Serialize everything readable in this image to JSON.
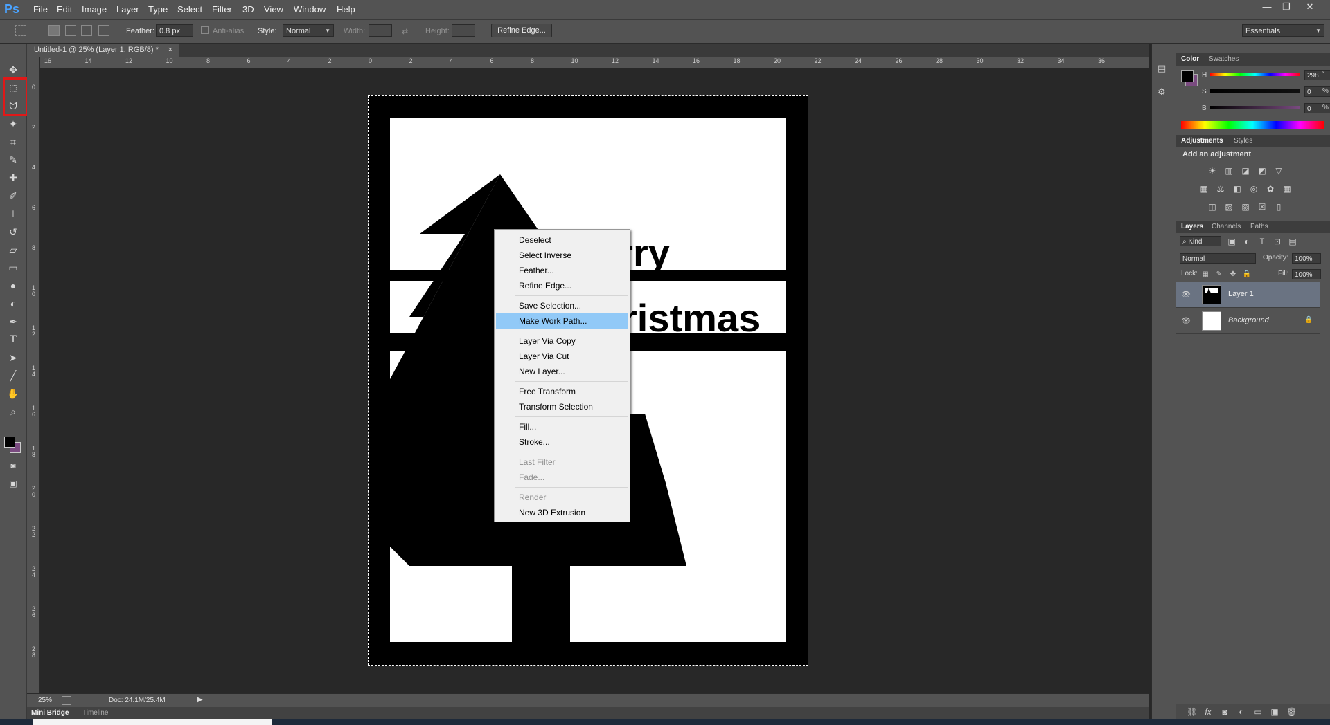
{
  "app": {
    "logo": "Ps",
    "menus": [
      "File",
      "Edit",
      "Image",
      "Layer",
      "Type",
      "Select",
      "Filter",
      "3D",
      "View",
      "Window",
      "Help"
    ],
    "window_controls": [
      "—",
      "❐",
      "✕"
    ]
  },
  "options_bar": {
    "feather_label": "Feather:",
    "feather_value": "0.8 px",
    "anti_alias_label": "Anti-alias",
    "style_label": "Style:",
    "style_value": "Normal",
    "width_label": "Width:",
    "height_label": "Height:",
    "refine_edge": "Refine Edge...",
    "workspace": "Essentials"
  },
  "document": {
    "tab_title": "Untitled-1 @ 25% (Layer 1, RGB/8) *",
    "close": "×",
    "canvas_text": {
      "word1": "erry",
      "word2": "ristmas"
    }
  },
  "ruler": {
    "h_ticks": [
      "16",
      "14",
      "12",
      "10",
      "8",
      "6",
      "4",
      "2",
      "0",
      "2",
      "4",
      "6",
      "8",
      "10",
      "12",
      "14",
      "16",
      "18",
      "20",
      "22",
      "24",
      "26",
      "28",
      "30",
      "32",
      "34",
      "36"
    ],
    "v_ticks": [
      "0",
      "2",
      "4",
      "6",
      "8",
      "1\n0",
      "1\n2",
      "1\n4",
      "1\n6",
      "1\n8",
      "2\n0",
      "2\n2",
      "2\n4",
      "2\n6",
      "2\n8"
    ]
  },
  "context_menu": {
    "items": [
      {
        "label": "Deselect",
        "state": "normal"
      },
      {
        "label": "Select Inverse",
        "state": "normal"
      },
      {
        "label": "Feather...",
        "state": "normal"
      },
      {
        "label": "Refine Edge...",
        "state": "normal"
      },
      {
        "label": "Save Selection...",
        "state": "normal"
      },
      {
        "label": "Make Work Path...",
        "state": "active"
      },
      {
        "label": "Layer Via Copy",
        "state": "normal"
      },
      {
        "label": "Layer Via Cut",
        "state": "normal"
      },
      {
        "label": "New Layer...",
        "state": "normal"
      },
      {
        "label": "Free Transform",
        "state": "normal"
      },
      {
        "label": "Transform Selection",
        "state": "normal"
      },
      {
        "label": "Fill...",
        "state": "normal"
      },
      {
        "label": "Stroke...",
        "state": "normal"
      },
      {
        "label": "Last Filter",
        "state": "disabled"
      },
      {
        "label": "Fade...",
        "state": "disabled"
      },
      {
        "label": "Render",
        "state": "disabled"
      },
      {
        "label": "New 3D Extrusion",
        "state": "normal"
      }
    ]
  },
  "status": {
    "zoom": "25%",
    "doc_size": "Doc: 24.1M/25.4M"
  },
  "bottom_tabs": [
    "Mini Bridge",
    "Timeline"
  ],
  "color_panel": {
    "tabs": [
      "Color",
      "Swatches"
    ],
    "h_label": "H",
    "h_value": "298",
    "h_unit": "°",
    "s_label": "S",
    "s_value": "0",
    "s_unit": "%",
    "b_label": "B",
    "b_value": "0",
    "b_unit": "%"
  },
  "adjustments_panel": {
    "tabs": [
      "Adjustments",
      "Styles"
    ],
    "heading": "Add an adjustment"
  },
  "layers_panel": {
    "tabs": [
      "Layers",
      "Channels",
      "Paths"
    ],
    "kind_label": "Kind",
    "blend_mode": "Normal",
    "opacity_label": "Opacity:",
    "opacity_value": "100%",
    "lock_label": "Lock:",
    "fill_label": "Fill:",
    "fill_value": "100%",
    "layers": [
      {
        "name": "Layer 1",
        "selected": true
      },
      {
        "name": "Background",
        "selected": false
      }
    ]
  },
  "colors": {
    "ps_blue": "#4aa3ff",
    "highlight_red": "#e01818",
    "menu_active": "#91c9f7",
    "foreground": "#000000",
    "background_swatch": "#7a4b80"
  }
}
